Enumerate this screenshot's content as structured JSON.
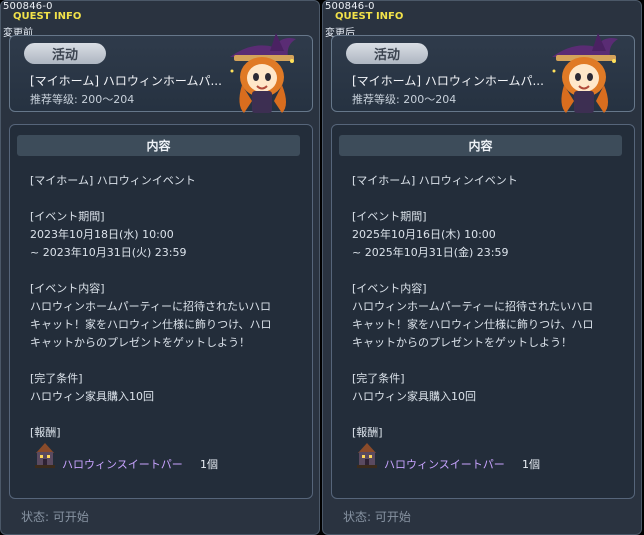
{
  "panels": [
    {
      "quest_id": "500846-0",
      "quest_info": "QUEST INFO",
      "variant": "変更前",
      "activity_label": "活动",
      "title": "[マイホーム] ハロウィンホームパ...",
      "level": "推荐等级:  200〜204",
      "content_header": "内容",
      "lines": [
        "[マイホーム] ハロウィンイベント",
        "[イベント期間]",
        "2023年10月18日(水) 10:00",
        "~ 2023年10月31日(火) 23:59",
        "[イベント内容]",
        "ハロウィンホームパーティーに招待されたいハロ",
        "キャット！家をハロウィン仕様に飾りつけ、ハロ",
        "キャットからのプレゼントをゲットしよう！",
        "[完了条件]",
        "ハロウィン家具購入10回",
        "[報酬]"
      ],
      "reward_name": "ハロウィンスイートパー",
      "reward_count": "1個",
      "status": "状态:  可开始"
    },
    {
      "quest_id": "500846-0",
      "quest_info": "QUEST INFO",
      "variant": "変更后",
      "activity_label": "活动",
      "title": "[マイホーム] ハロウィンホームパ...",
      "level": "推荐等级:  200〜204",
      "content_header": "内容",
      "lines": [
        "[マイホーム] ハロウィンイベント",
        "[イベント期間]",
        "2025年10月16日(木) 10:00",
        "~ 2025年10月31日(金) 23:59",
        "[イベント内容]",
        "ハロウィンホームパーティーに招待されたいハロ",
        "キャット！家をハロウィン仕様に飾りつけ、ハロ",
        "キャットからのプレゼントをゲットしよう！",
        "[完了条件]",
        "ハロウィン家具購入10回",
        "[報酬]"
      ],
      "reward_name": "ハロウィンスイートパー",
      "reward_count": "1個",
      "status": "状态:  可开始"
    }
  ],
  "icons": {
    "npc": "witch-girl-portrait-icon",
    "reward": "haunted-house-item-icon"
  },
  "colors": {
    "quest_info": "#f2e24a",
    "reward_name": "#c8a3ff",
    "panel_bg": "#2a3340"
  }
}
